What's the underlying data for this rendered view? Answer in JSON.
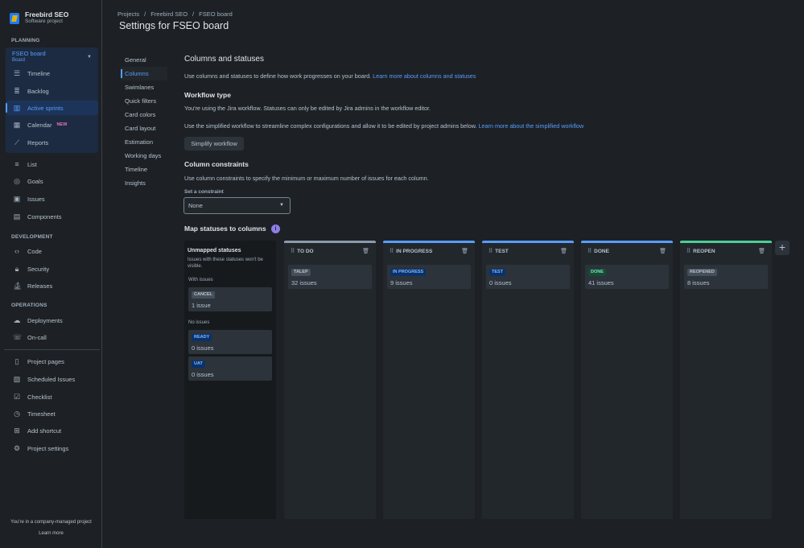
{
  "project": {
    "name": "Freebird SEO",
    "type": "Software project"
  },
  "sidebar": {
    "planning_label": "PLANNING",
    "board": {
      "name": "FSEO board",
      "sub": "Board"
    },
    "planning_items": [
      {
        "label": "Timeline",
        "icon": "timeline-icon"
      },
      {
        "label": "Backlog",
        "icon": "backlog-icon"
      },
      {
        "label": "Active sprints",
        "icon": "board-icon"
      },
      {
        "label": "Calendar",
        "icon": "calendar-icon",
        "badge": "NEW"
      },
      {
        "label": "Reports",
        "icon": "reports-icon"
      }
    ],
    "other_items": [
      {
        "label": "List",
        "icon": "list-icon"
      },
      {
        "label": "Goals",
        "icon": "goals-icon"
      },
      {
        "label": "Issues",
        "icon": "issues-icon"
      },
      {
        "label": "Components",
        "icon": "components-icon"
      }
    ],
    "development_label": "DEVELOPMENT",
    "development_items": [
      {
        "label": "Code",
        "icon": "code-icon"
      },
      {
        "label": "Security",
        "icon": "lock-icon"
      },
      {
        "label": "Releases",
        "icon": "ship-icon"
      }
    ],
    "operations_label": "OPERATIONS",
    "operations_items": [
      {
        "label": "Deployments",
        "icon": "cloud-icon"
      },
      {
        "label": "On-call",
        "icon": "phone-icon"
      }
    ],
    "extra_items": [
      {
        "label": "Project pages",
        "icon": "page-icon"
      },
      {
        "label": "Scheduled Issues",
        "icon": "schedule-icon"
      },
      {
        "label": "Checklist",
        "icon": "checklist-icon"
      },
      {
        "label": "Timesheet",
        "icon": "clock-icon"
      },
      {
        "label": "Add shortcut",
        "icon": "add-shortcut-icon"
      },
      {
        "label": "Project settings",
        "icon": "gear-icon"
      }
    ],
    "footer": {
      "text": "You're in a company-managed project",
      "link": "Learn more"
    }
  },
  "breadcrumb": [
    "Projects",
    "/",
    "Freebird SEO",
    "/",
    "FSEO board"
  ],
  "page_title": "Settings for FSEO board",
  "settings_nav": [
    "General",
    "Columns",
    "Swimlanes",
    "Quick filters",
    "Card colors",
    "Card layout",
    "Estimation",
    "Working days",
    "Timeline",
    "Insights"
  ],
  "content": {
    "title": "Columns and statuses",
    "intro": "Use columns and statuses to define how work progresses on your board.",
    "intro_link": "Learn more about columns and statuses",
    "workflow_title": "Workflow type",
    "workflow_text": "You're using the Jira workflow. Statuses can only be edited by Jira admins in the workflow editor.",
    "simplified_text": "Use the simplified workflow to streamline complex configurations and allow it to be edited by project admins below.",
    "simplified_link": "Learn more about the simplified workflow",
    "simplify_button": "Simplify workflow",
    "constraints_title": "Column constraints",
    "constraints_text": "Use column constraints to specify the minimum or maximum number of issues for each column.",
    "constraint_label": "Set a constraint",
    "constraint_value": "None",
    "map_title": "Map statuses to columns",
    "info_glyph": "i"
  },
  "unmapped": {
    "title": "Unmapped statuses",
    "desc": "Issues with these statuses won't be visible.",
    "with_issues_label": "With issues",
    "no_issues_label": "No issues",
    "cancel": {
      "status": "CANCEL",
      "count": "1 issue"
    },
    "ready": {
      "status": "READY",
      "count": "0 issues"
    },
    "uat": {
      "status": "UAT",
      "count": "0 issues"
    }
  },
  "columns": [
    {
      "name": "TO DO",
      "status": "TALEP",
      "count": "32 issues",
      "bar": "#8c9bab"
    },
    {
      "name": "IN PROGRESS",
      "status": "IN PROGRESS",
      "count": "9 issues",
      "bar": "#579dff"
    },
    {
      "name": "TEST",
      "status": "TEST",
      "count": "0 issues",
      "bar": "#579dff"
    },
    {
      "name": "DONE",
      "status": "DONE",
      "count": "41 issues",
      "bar": "#579dff"
    },
    {
      "name": "REOPEN",
      "status": "REOPENED",
      "count": "8 issues",
      "bar": "#4bce97"
    }
  ],
  "add_column_glyph": "+",
  "colors": {
    "accent": "#579dff",
    "green": "#4bce97",
    "bg": "#1d2125"
  }
}
